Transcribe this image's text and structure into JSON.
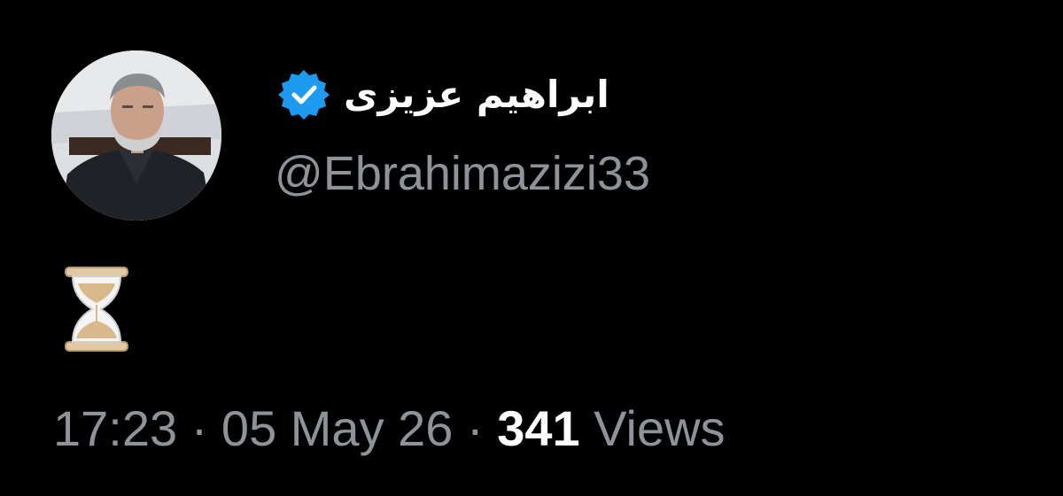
{
  "tweet": {
    "author": {
      "display_name": "ابراهیم عزیزی",
      "handle": "@Ebrahimazizi33",
      "verified": true,
      "verified_color": "#1d9bf0"
    },
    "body_icon": "hourglass-icon",
    "meta": {
      "time": "17:23",
      "separator": "·",
      "date": "05 May 26",
      "views_count": "341",
      "views_label": "Views"
    }
  }
}
